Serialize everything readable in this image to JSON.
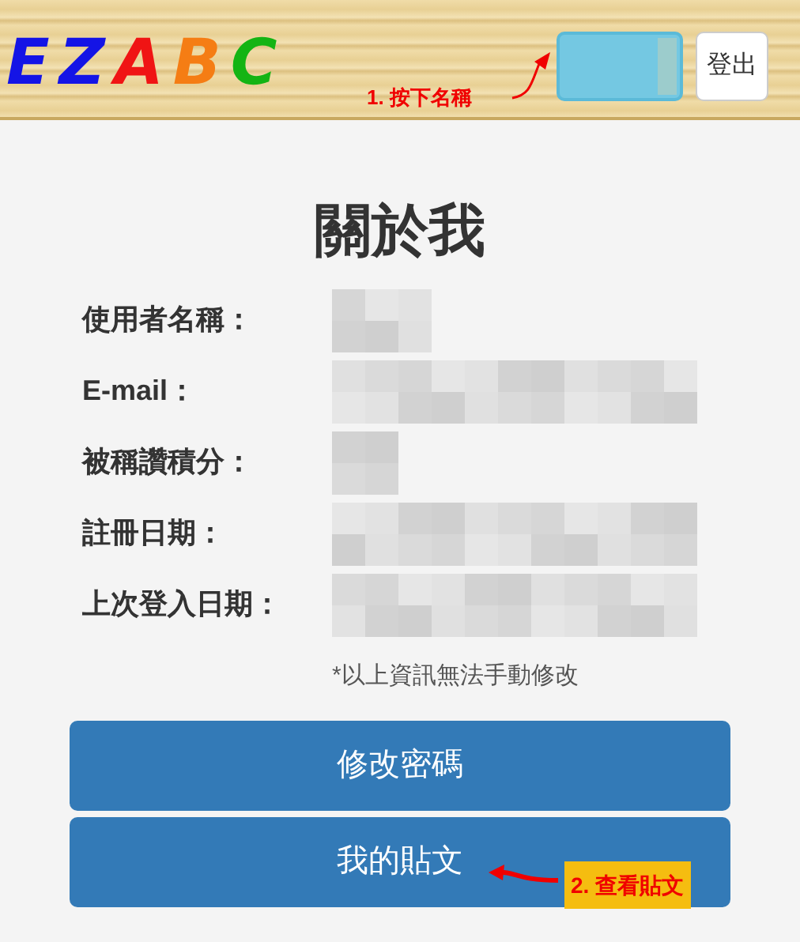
{
  "header": {
    "logo": [
      {
        "letter": "E",
        "color": "#1414e6"
      },
      {
        "letter": "Z",
        "color": "#1414e6"
      },
      {
        "letter": "A",
        "color": "#f01414"
      },
      {
        "letter": "B",
        "color": "#f57d14"
      },
      {
        "letter": "C",
        "color": "#14b414"
      }
    ],
    "annotation": "1. 按下名稱",
    "logout": "登出"
  },
  "title": "關於我",
  "fields": [
    {
      "label": "使用者名稱："
    },
    {
      "label": "E-mail："
    },
    {
      "label": "被稱讚積分："
    },
    {
      "label": "註冊日期："
    },
    {
      "label": "上次登入日期："
    }
  ],
  "note": "*以上資訊無法手動修改",
  "buttons": [
    "修改密碼",
    "我的貼文"
  ],
  "annotation_2": "2. 查看貼文"
}
